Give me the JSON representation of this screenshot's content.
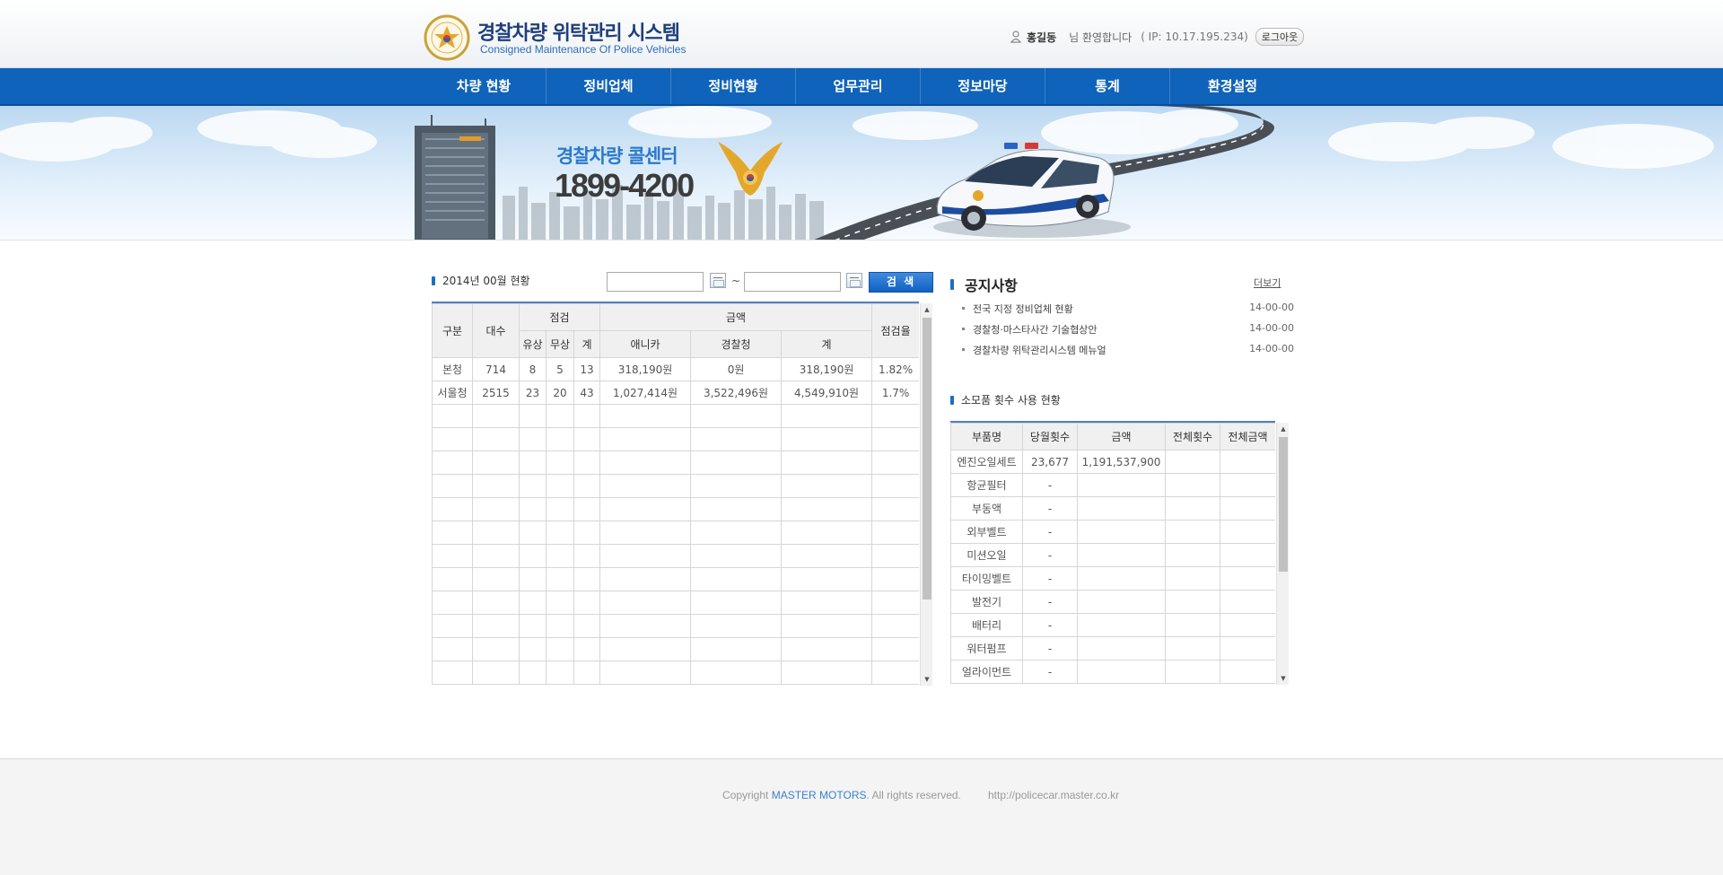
{
  "header": {
    "title": "경찰차량 위탁관리 시스템",
    "subtitle": "Consigned Maintenance Of Police Vehicles",
    "user_name": "홍길동",
    "greeting": "님 환영합니다",
    "ip_text": "( IP: 10.17.195.234)",
    "logout_label": "로그아웃"
  },
  "nav": {
    "items": [
      "차량 현황",
      "정비업체",
      "정비현황",
      "업무관리",
      "정보마당",
      "통계",
      "환경설정"
    ]
  },
  "banner": {
    "call_center_title": "경찰차량 콜센터",
    "call_center_number": "1899-4200"
  },
  "status_panel": {
    "title": "2014년 00월 현황",
    "date_from": "",
    "date_to": "",
    "tilde": "~",
    "search_label": "검 색",
    "headers": {
      "category": "구분",
      "count": "대수",
      "inspection": "점검",
      "paid": "유상",
      "free": "무상",
      "total": "계",
      "amount": "금액",
      "anyca": "애니카",
      "police": "경찰청",
      "amount_total": "계",
      "rate": "점검율"
    },
    "rows": [
      [
        "본청",
        "714",
        "8",
        "5",
        "13",
        "318,190원",
        "0원",
        "318,190원",
        "1.82%"
      ],
      [
        "서울청",
        "2515",
        "23",
        "20",
        "43",
        "1,027,414원",
        "3,522,496원",
        "4,549,910원",
        "1.7%"
      ],
      [
        "",
        "",
        "",
        "",
        "",
        "",
        "",
        "",
        ""
      ],
      [
        "",
        "",
        "",
        "",
        "",
        "",
        "",
        "",
        ""
      ],
      [
        "",
        "",
        "",
        "",
        "",
        "",
        "",
        "",
        ""
      ],
      [
        "",
        "",
        "",
        "",
        "",
        "",
        "",
        "",
        ""
      ],
      [
        "",
        "",
        "",
        "",
        "",
        "",
        "",
        "",
        ""
      ],
      [
        "",
        "",
        "",
        "",
        "",
        "",
        "",
        "",
        ""
      ],
      [
        "",
        "",
        "",
        "",
        "",
        "",
        "",
        "",
        ""
      ],
      [
        "",
        "",
        "",
        "",
        "",
        "",
        "",
        "",
        ""
      ],
      [
        "",
        "",
        "",
        "",
        "",
        "",
        "",
        "",
        ""
      ],
      [
        "",
        "",
        "",
        "",
        "",
        "",
        "",
        "",
        ""
      ],
      [
        "",
        "",
        "",
        "",
        "",
        "",
        "",
        "",
        ""
      ],
      [
        "",
        "",
        "",
        "",
        "",
        "",
        "",
        "",
        ""
      ]
    ]
  },
  "notice": {
    "title": "공지사항",
    "more_label": "더보기",
    "items": [
      {
        "text": "전국 지정 정비업체 현황",
        "date": "14-00-00"
      },
      {
        "text": "경찰청·마스타사간 기술협상안",
        "date": "14-00-00"
      },
      {
        "text": "경찰차량 위탁관리시스템 메뉴얼",
        "date": "14-00-00"
      }
    ]
  },
  "consumables": {
    "title": "소모품 횟수 사용 현황",
    "headers": [
      "부품명",
      "당월횟수",
      "금액",
      "전체횟수",
      "전체금액"
    ],
    "rows": [
      [
        "엔진오일세트",
        "23,677",
        "1,191,537,900",
        "",
        ""
      ],
      [
        "항균필터",
        "-",
        "",
        "",
        ""
      ],
      [
        "부동액",
        "-",
        "",
        "",
        ""
      ],
      [
        "외부벨트",
        "-",
        "",
        "",
        ""
      ],
      [
        "미션오일",
        "-",
        "",
        "",
        ""
      ],
      [
        "타이밍벨트",
        "-",
        "",
        "",
        ""
      ],
      [
        "발전기",
        "-",
        "",
        "",
        ""
      ],
      [
        "배터리",
        "-",
        "",
        "",
        ""
      ],
      [
        "워터펌프",
        "-",
        "",
        "",
        ""
      ],
      [
        "얼라이먼트",
        "-",
        "",
        "",
        ""
      ]
    ]
  },
  "footer": {
    "copyright_prefix": "Copyright ",
    "brand": "MASTER MOTORS",
    "copyright_suffix": ". All rights reserved.",
    "url": "http://policecar.master.co.kr"
  },
  "colors": {
    "nav_blue": "#1063ba",
    "accent_blue": "#2b78cc",
    "table_header_bg": "#f0f0f0"
  },
  "icons": [
    "police-emblem-icon",
    "user-icon",
    "calendar-icon",
    "scroll-up-icon",
    "scroll-down-icon"
  ]
}
